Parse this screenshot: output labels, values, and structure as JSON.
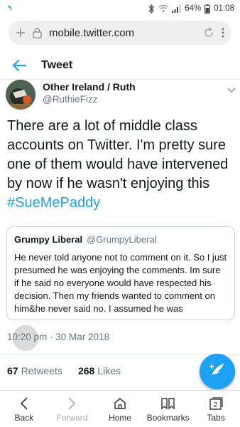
{
  "status_bar": {
    "battery_percent": "64%",
    "time": "01:08"
  },
  "browser": {
    "url": "mobile.twitter.com"
  },
  "header": {
    "title": "Tweet"
  },
  "tweet": {
    "author_name": "Other Ireland / Ruth",
    "author_handle": "@RuthieFizz",
    "text": "There are a lot of middle class accounts on Twitter. I'm pretty sure one of them would have intervened by now if he wasn't enjoying this ",
    "hashtag": "#SueMePaddy",
    "timestamp": "10:20 pm · 30 Mar 2018",
    "retweets_count": "67",
    "retweets_label": "Retweets",
    "likes_count": "268",
    "likes_label": "Likes"
  },
  "quote": {
    "name": "Grumpy Liberal",
    "handle": "@GrumpyLiberal",
    "text": "He never told anyone not to comment on it. So I just presumed he was enjoying the comments. Im sure if he said no everyone would have respected his decision. Then my friends wanted to comment on him&he never said no. I assumed he was"
  },
  "bottom_nav": {
    "back": "Back",
    "forward": "Forward",
    "home": "Home",
    "bookmarks": "Bookmarks",
    "tabs": "Tabs",
    "tabs_count": "2"
  },
  "colors": {
    "accent": "#1da1f2",
    "secondary_text": "#657786"
  },
  "icons": [
    "bluetooth-icon",
    "wifi-icon",
    "signal-icon",
    "battery-icon",
    "add-tab-icon",
    "lock-icon",
    "refresh-icon",
    "more-icon",
    "back-arrow-icon",
    "chevron-down-icon",
    "compose-icon",
    "back-icon",
    "forward-icon",
    "home-icon",
    "bookmarks-icon",
    "tabs-icon"
  ]
}
